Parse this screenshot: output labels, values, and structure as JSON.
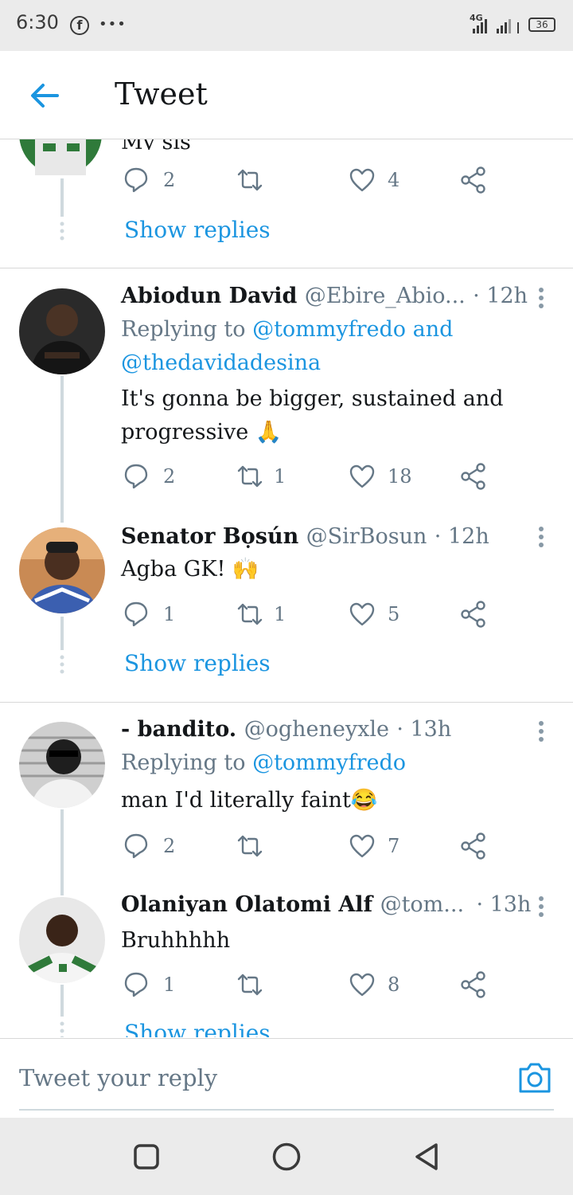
{
  "status_bar": {
    "time": "6:30",
    "network": "4G",
    "battery": "36",
    "notifications": "•••",
    "fb_letter": "f"
  },
  "header": {
    "title": "Tweet"
  },
  "top_fragment": {
    "text_partial": "My sis",
    "actions": {
      "replies": "2",
      "retweets": "",
      "likes": "4"
    },
    "show_replies": "Show replies"
  },
  "tweets": [
    {
      "name": "Abiodun David",
      "handle": "@Ebire_Abio...",
      "time": "· 12h",
      "replying_prefix": "Replying to ",
      "replying_line1": "@tommyfredo and",
      "replying_line2": "@thedavidadesina",
      "text_line1": "It's gonna be bigger, sustained and",
      "text_line2": "progressive 🙏",
      "actions": {
        "replies": "2",
        "retweets": "1",
        "likes": "18"
      }
    },
    {
      "name": "Senator Bọsún",
      "handle": "@SirBosun",
      "time": "· 12h",
      "text_line1": "Agba GK!  🙌",
      "actions": {
        "replies": "1",
        "retweets": "1",
        "likes": "5"
      },
      "show_replies": "Show replies"
    },
    {
      "name": "- bandito.",
      "handle": "@ogheneyxle",
      "time": "· 13h",
      "replying_prefix": "Replying to ",
      "replying_line1": "@tommyfredo",
      "text_line1": "man I'd literally faint😂",
      "actions": {
        "replies": "2",
        "retweets": "",
        "likes": "7"
      }
    },
    {
      "name": "Olaniyan Olatomi Alf",
      "handle": "@tom...",
      "time": "· 13h",
      "text_line1": "Bruhhhhh",
      "actions": {
        "replies": "1",
        "retweets": "",
        "likes": "8"
      },
      "show_replies": "Show replies"
    }
  ],
  "reply_bar": {
    "placeholder": "Tweet your reply"
  },
  "colors": {
    "accent": "#1b95e0",
    "muted": "#657786",
    "text": "#14171a",
    "thread_line": "#cfd9de"
  },
  "icons": [
    "back-arrow-icon",
    "reply-icon",
    "retweet-icon",
    "like-icon",
    "share-icon",
    "more-vertical-icon",
    "camera-icon",
    "nav-recents-icon",
    "nav-home-icon",
    "nav-back-icon"
  ]
}
